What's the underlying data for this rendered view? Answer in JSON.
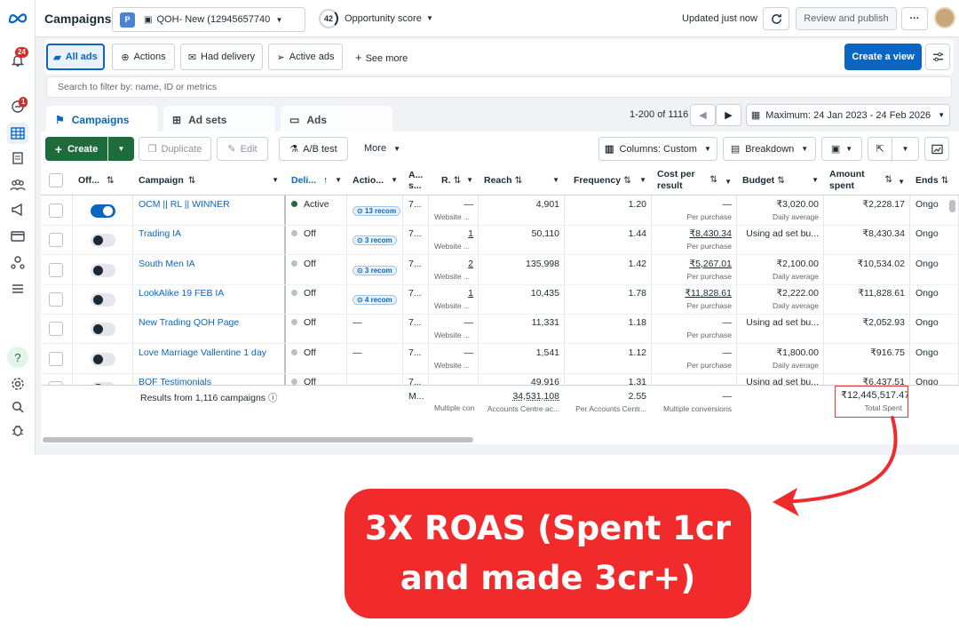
{
  "topbar": {
    "title": "Campaigns",
    "account_badge": "P",
    "account_name": "QOH- New (12945657740...",
    "score_value": "42",
    "score_label": "Opportunity score",
    "updated": "Updated just now",
    "review_label": "Review and publish"
  },
  "rail": {
    "notifications_count": "24",
    "alerts_count": "1"
  },
  "filters": {
    "all_ads": "All ads",
    "actions": "Actions",
    "had_delivery": "Had delivery",
    "active_ads": "Active ads",
    "see_more": "See more",
    "create_view": "Create a view"
  },
  "search": {
    "placeholder": "Search to filter by: name, ID or metrics"
  },
  "tabs": {
    "campaigns": "Campaigns",
    "adsets": "Ad sets",
    "ads": "Ads"
  },
  "pagination": {
    "range": "1-200 of 1116",
    "date_range": "Maximum: 24 Jan 2023 - 24 Feb 2026"
  },
  "toolbar": {
    "create": "Create",
    "duplicate": "Duplicate",
    "edit": "Edit",
    "abtest": "A/B test",
    "more": "More",
    "columns": "Columns: Custom",
    "breakdown": "Breakdown"
  },
  "headers": {
    "offon": "Off...",
    "campaign": "Campaign",
    "delivery": "Deli...",
    "actions": "Actio...",
    "attr1": "A...",
    "attr2": "s...",
    "results": "R.",
    "reach": "Reach",
    "frequency": "Frequency",
    "cost1": "Cost per",
    "cost2": "result",
    "budget": "Budget",
    "spent1": "Amount",
    "spent2": "spent",
    "ends": "Ends"
  },
  "rows": [
    {
      "on": true,
      "name": "OCM || RL || WINNER",
      "delivery": "Active",
      "active": true,
      "actions": "13 recom",
      "attr": "7...",
      "result": "—",
      "result_sub": "Website ...",
      "reach": "4,901",
      "freq": "1.20",
      "cost": "—",
      "cost_sub": "Per purchase",
      "budget": "₹3,020.00",
      "budget_sub": "Daily average",
      "spent": "₹2,228.17",
      "ends": "Ongo"
    },
    {
      "on": false,
      "name": "Trading IA",
      "delivery": "Off",
      "active": false,
      "actions": "3 recom",
      "attr": "7...",
      "result": "1",
      "result_sub": "Website ...",
      "reach": "50,110",
      "freq": "1.44",
      "cost": "₹8,430.34",
      "cost_sub": "Per purchase",
      "budget": "Using ad set bu...",
      "budget_sub": "",
      "spent": "₹8,430.34",
      "ends": "Ongo"
    },
    {
      "on": false,
      "name": "South Men IA",
      "delivery": "Off",
      "active": false,
      "actions": "3 recom",
      "attr": "7...",
      "result": "2",
      "result_sub": "Website ...",
      "reach": "135,998",
      "freq": "1.42",
      "cost": "₹5,267.01",
      "cost_sub": "Per purchase",
      "budget": "₹2,100.00",
      "budget_sub": "Daily average",
      "spent": "₹10,534.02",
      "ends": "Ongo"
    },
    {
      "on": false,
      "name": "LookAlike 19 FEB IA",
      "delivery": "Off",
      "active": false,
      "actions": "4 recom",
      "attr": "7...",
      "result": "1",
      "result_sub": "Website ...",
      "reach": "10,435",
      "freq": "1.78",
      "cost": "₹11,828.61",
      "cost_sub": "Per purchase",
      "budget": "₹2,222.00",
      "budget_sub": "Daily average",
      "spent": "₹11,828.61",
      "ends": "Ongo"
    },
    {
      "on": false,
      "name": "New Trading QOH Page",
      "delivery": "Off",
      "active": false,
      "actions": "—",
      "attr": "7...",
      "result": "—",
      "result_sub": "Website ...",
      "reach": "11,331",
      "freq": "1.18",
      "cost": "—",
      "cost_sub": "Per purchase",
      "budget": "Using ad set bu...",
      "budget_sub": "",
      "spent": "₹2,052.93",
      "ends": "Ongo"
    },
    {
      "on": false,
      "name": "Love Marriage Vallentine 1 day",
      "delivery": "Off",
      "active": false,
      "actions": "—",
      "attr": "7...",
      "result": "—",
      "result_sub": "Website ...",
      "reach": "1,541",
      "freq": "1.12",
      "cost": "—",
      "cost_sub": "Per purchase",
      "budget": "₹1,800.00",
      "budget_sub": "Daily average",
      "spent": "₹916.75",
      "ends": "Ongo"
    },
    {
      "on": false,
      "name": "BOF Testimonials",
      "delivery": "Off",
      "active": false,
      "actions": "",
      "attr": "7...",
      "result": "",
      "result_sub": "",
      "reach": "49,916",
      "freq": "1.31",
      "cost": "",
      "cost_sub": "",
      "budget": "Using ad set bu...",
      "budget_sub": "",
      "spent": "₹6,437.51",
      "ends": "Ongo"
    }
  ],
  "totals": {
    "label": "Results from 1,116 campaigns",
    "attr": "M...",
    "results_sub": "Multiple con",
    "reach": "34,531,108",
    "reach_sub": "Accounts Centre ac...",
    "freq": "2.55",
    "freq_sub": "Per Accounts Centr...",
    "cost": "—",
    "cost_sub": "Multiple conversions",
    "spent": "₹12,445,517.47",
    "spent_sub": "Total Spent"
  },
  "callout": {
    "line1": "3X ROAS (Spent 1cr",
    "line2": "and made 3cr+)"
  },
  "colors": {
    "accent": "#0a66c2",
    "create": "#1e6b3c",
    "callout": "#f12b2b",
    "active_dot": "#1e6b3c"
  }
}
